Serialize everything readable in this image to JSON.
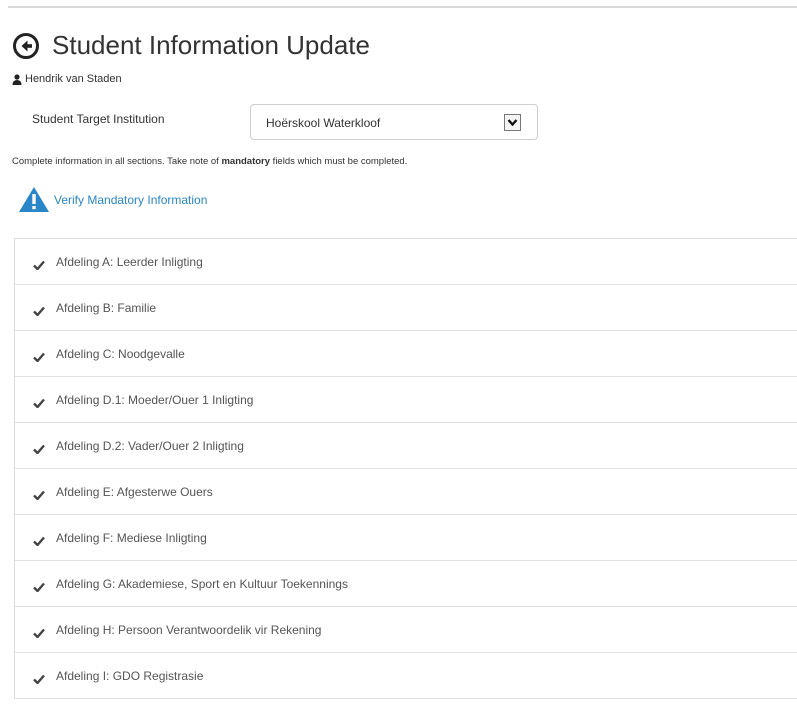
{
  "page": {
    "title": "Student Information Update",
    "user_name": "Hendrik van Staden"
  },
  "institution": {
    "label": "Student Target Institution",
    "selected": "Hoërskool Waterkloof"
  },
  "instructions": {
    "before": "Complete information in all sections. Take note of ",
    "bold": "mandatory",
    "after": " fields which must be completed."
  },
  "verify": {
    "label": "Verify Mandatory Information"
  },
  "sections": [
    {
      "label": "Afdeling A: Leerder Inligting"
    },
    {
      "label": "Afdeling B: Familie"
    },
    {
      "label": "Afdeling C: Noodgevalle"
    },
    {
      "label": "Afdeling D.1: Moeder/Ouer 1 Inligting"
    },
    {
      "label": "Afdeling D.2: Vader/Ouer 2 Inligting"
    },
    {
      "label": "Afdeling E: Afgesterwe Ouers"
    },
    {
      "label": "Afdeling F: Mediese Inligting"
    },
    {
      "label": "Afdeling G: Akademiese, Sport en Kultuur Toekennings"
    },
    {
      "label": "Afdeling H: Persoon Verantwoordelik vir Rekening"
    },
    {
      "label": "Afdeling I: GDO Registrasie"
    }
  ],
  "icons": {
    "back": "circle-arrow-left-icon",
    "user": "user-icon",
    "warning": "warning-triangle-icon",
    "check": "check-icon",
    "dropdown": "chevron-down-icon"
  },
  "colors": {
    "link": "#2a86c9",
    "warning": "#2a86c9",
    "text": "#333333"
  }
}
